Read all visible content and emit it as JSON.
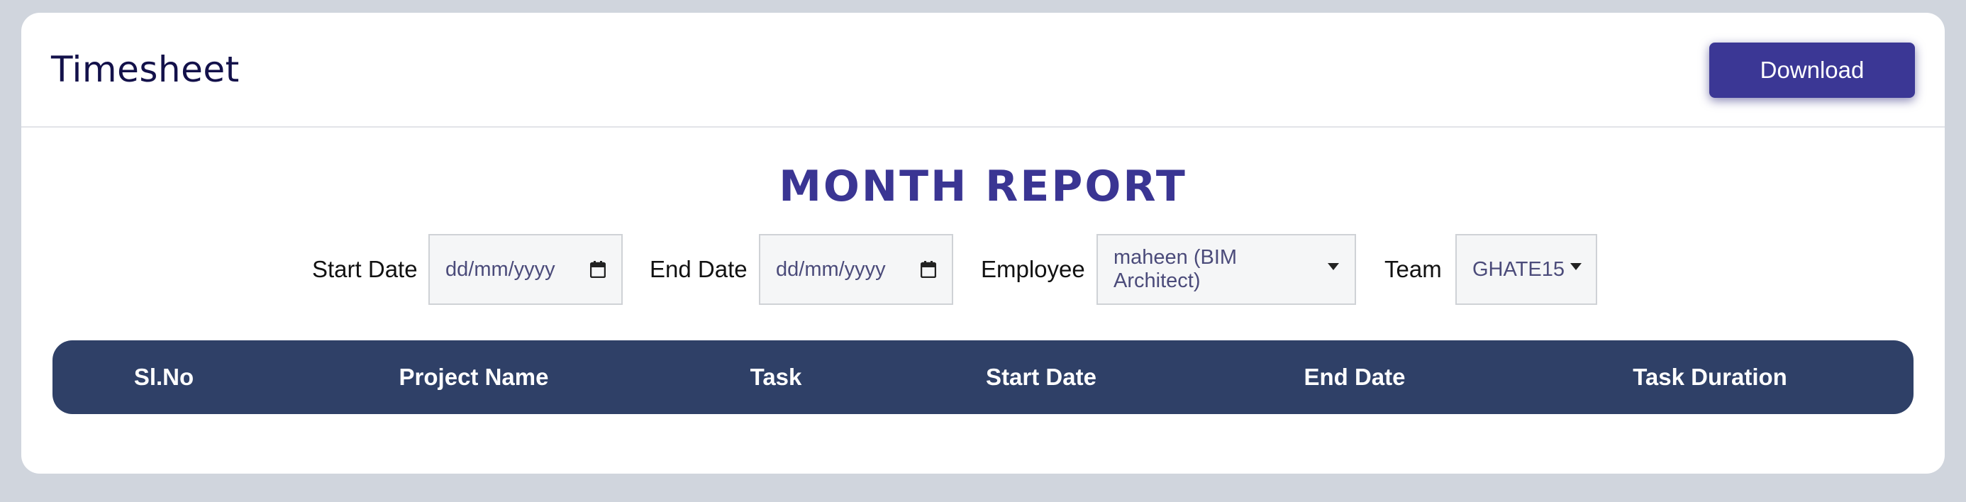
{
  "header": {
    "title": "Timesheet",
    "download_label": "Download"
  },
  "report": {
    "title": "MONTH REPORT"
  },
  "filters": {
    "start_date_label": "Start Date",
    "start_date_placeholder": "dd/mm/yyyy",
    "end_date_label": "End Date",
    "end_date_placeholder": "dd/mm/yyyy",
    "employee_label": "Employee",
    "employee_value": "maheen (BIM Architect)",
    "team_label": "Team",
    "team_value": "GHATE15"
  },
  "table": {
    "columns": [
      "Sl.No",
      "Project Name",
      "Task",
      "Start Date",
      "End Date",
      "Task Duration"
    ]
  },
  "colors": {
    "accent": "#3b3795",
    "table_header": "#2f4067",
    "title": "#13114a"
  },
  "icons": {
    "calendar": "calendar-icon",
    "dropdown": "caret-down-icon"
  }
}
